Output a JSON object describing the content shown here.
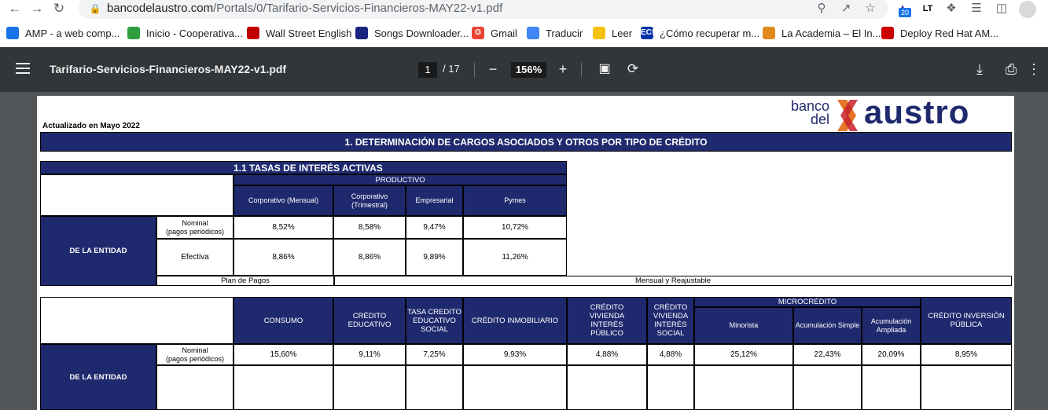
{
  "browser": {
    "url_domain": "bancodelaustro.com",
    "url_path": "/Portals/0/Tarifario-Servicios-Financieros-MAY22-v1.pdf",
    "extension_badge": "20",
    "bookmarks": [
      {
        "label": "AMP - a web comp...",
        "color": "#1a73e8"
      },
      {
        "label": "Inicio - Cooperativa...",
        "color": "#2e9e3e"
      },
      {
        "label": "Wall Street English",
        "color": "#c00000"
      },
      {
        "label": "Songs Downloader...",
        "color": "#1a237e"
      },
      {
        "label": "Gmail",
        "color": "#ea4335",
        "icon_text": "G"
      },
      {
        "label": "Traducir",
        "color": "#4285f4"
      },
      {
        "label": "Leer",
        "color": "#f4c20d"
      },
      {
        "label": "¿Cómo recuperar m...",
        "color": "#0033aa",
        "icon_text": "EC!"
      },
      {
        "label": "La Academia – El In...",
        "color": "#e08a1e"
      },
      {
        "label": "Deploy Red Hat AM...",
        "color": "#cc0000"
      }
    ]
  },
  "pdf_toolbar": {
    "title": "Tarifario-Servicios-Financieros-MAY22-v1.pdf",
    "current_page": "1",
    "total_pages": "/ 17",
    "zoom": "156%"
  },
  "document": {
    "logo_banco": "banco",
    "logo_del": "del",
    "logo_austro": "austro",
    "updated": "Actualizado en Mayo 2022",
    "section_title": "1. DETERMINACIÓN DE CARGOS ASOCIADOS Y OTROS POR  TIPO DE CRÉDITO",
    "subsection_title": "1.1 TASAS DE INTERÉS ACTIVAS",
    "table1": {
      "group_header": "PRODUCTIVO",
      "columns": [
        "Corporativo (Mensual)",
        "Corporativo\n(Trimestral)",
        "Empresarial",
        "Pymes"
      ],
      "entity_label": "DE LA ENTIDAD",
      "nominal_label": "Nominal\n(pagos periódicos)",
      "efectiva_label": "Efectiva",
      "nominal_values": [
        "8,52%",
        "8,58%",
        "9,47%",
        "10,72%"
      ],
      "efectiva_values": [
        "8,86%",
        "8,86%",
        "9,89%",
        "11,26%"
      ],
      "plan_label": "Plan de Pagos",
      "plan_value": "Mensual y Reajustable"
    },
    "table2": {
      "columns": [
        "CONSUMO",
        "CRÉDITO\nEDUCATIVO",
        "TASA CREDITO\nEDUCATIVO\nSOCIAL",
        "CRÉDITO INMOBILIARIO",
        "CRÉDITO\nVIVIENDA\nINTERÉS\nPÚBLICO",
        "CRÉDITO\nVIVIENDA\nINTERÉS SOCIAL"
      ],
      "micro_header": "MICROCRÉDITO",
      "micro_columns": [
        "Minorista",
        "Acumulación Simple",
        "Acumulación\nAmpliada"
      ],
      "last_column": "CRÉDITO INVERSIÓN\nPÚBLICA",
      "nominal_label": "Nominal\n(pagos periódicos)",
      "entity_label": "DE LA ENTIDAD",
      "nominal_values": [
        "15,60%",
        "9,11%",
        "7,25%",
        "9,93%",
        "4,88%",
        "4,88%",
        "25,12%",
        "22,43%",
        "20,09%",
        "8,95%"
      ]
    }
  }
}
